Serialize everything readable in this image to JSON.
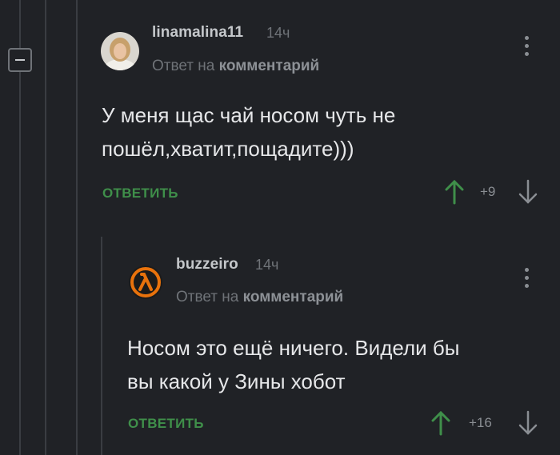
{
  "comments": [
    {
      "username": "linamalina11",
      "time": "14ч",
      "reply_prefix": "Ответ на",
      "reply_target": "комментарий",
      "text_lines": [
        "У меня щас чай носом чуть не",
        "пошёл,хватит,пощадите)))"
      ],
      "reply_label": "ОТВЕТИТЬ",
      "score": "+9"
    },
    {
      "username": "buzzeiro",
      "time": "14ч",
      "reply_prefix": "Ответ на",
      "reply_target": "комментарий",
      "text_lines": [
        "Носом это ещё ничего. Видели бы",
        "вы какой у Зины хобот"
      ],
      "reply_label": "ОТВЕТИТЬ",
      "score": "+16"
    }
  ],
  "colors": {
    "background": "#202226",
    "accent_green": "#3f8f4a",
    "thread_line": "#3a3d42",
    "avatar_orange": "#e8720c"
  },
  "icons": {
    "collapse": "minus-icon",
    "more": "kebab-menu-icon",
    "upvote": "arrow-up-icon",
    "downvote": "arrow-down-icon",
    "avatar2": "lambda-logo-icon"
  }
}
